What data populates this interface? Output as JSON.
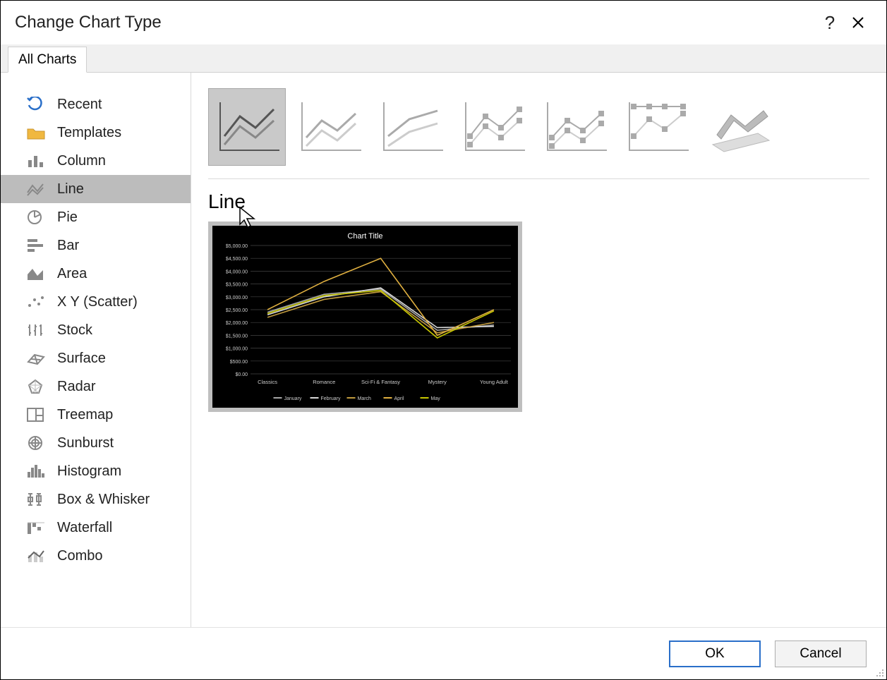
{
  "titlebar": {
    "title": "Change Chart Type",
    "help": "?",
    "close": "✕"
  },
  "tab": {
    "label": "All Charts"
  },
  "sidebar": {
    "items": [
      {
        "label": "Recent",
        "icon": "recent-icon"
      },
      {
        "label": "Templates",
        "icon": "templates-icon"
      },
      {
        "label": "Column",
        "icon": "column-icon"
      },
      {
        "label": "Line",
        "icon": "line-icon"
      },
      {
        "label": "Pie",
        "icon": "pie-icon"
      },
      {
        "label": "Bar",
        "icon": "bar-icon"
      },
      {
        "label": "Area",
        "icon": "area-icon"
      },
      {
        "label": "X Y (Scatter)",
        "icon": "scatter-icon"
      },
      {
        "label": "Stock",
        "icon": "stock-icon"
      },
      {
        "label": "Surface",
        "icon": "surface-icon"
      },
      {
        "label": "Radar",
        "icon": "radar-icon"
      },
      {
        "label": "Treemap",
        "icon": "treemap-icon"
      },
      {
        "label": "Sunburst",
        "icon": "sunburst-icon"
      },
      {
        "label": "Histogram",
        "icon": "histogram-icon"
      },
      {
        "label": "Box & Whisker",
        "icon": "boxwhisker-icon"
      },
      {
        "label": "Waterfall",
        "icon": "waterfall-icon"
      },
      {
        "label": "Combo",
        "icon": "combo-icon"
      }
    ],
    "selected_index": 3
  },
  "subtypes": {
    "selected_index": 0,
    "items": [
      {
        "name": "line"
      },
      {
        "name": "stacked-line"
      },
      {
        "name": "100-stacked-line"
      },
      {
        "name": "line-markers"
      },
      {
        "name": "stacked-line-markers"
      },
      {
        "name": "100-stacked-line-markers"
      },
      {
        "name": "3d-line"
      }
    ]
  },
  "heading": "Line",
  "footer": {
    "ok": "OK",
    "cancel": "Cancel"
  },
  "chart_data": {
    "type": "line",
    "title": "Chart Title",
    "xlabel": "",
    "ylabel": "",
    "ylim": [
      0,
      5000
    ],
    "yticks": [
      "$0.00",
      "$500.00",
      "$1,000.00",
      "$1,500.00",
      "$2,000.00",
      "$2,500.00",
      "$3,000.00",
      "$3,500.00",
      "$4,000.00",
      "$4,500.00",
      "$5,000.00"
    ],
    "categories": [
      "Classics",
      "Romance",
      "Sci-Fi & Fantasy",
      "Mystery",
      "Young Adult"
    ],
    "series": [
      {
        "name": "January",
        "color": "#a6a6a6",
        "values": [
          2400,
          3100,
          3300,
          1700,
          1900
        ]
      },
      {
        "name": "February",
        "color": "#d9d9d9",
        "values": [
          2300,
          3000,
          3350,
          1800,
          1850
        ]
      },
      {
        "name": "March",
        "color": "#c09a3e",
        "values": [
          2200,
          2900,
          3200,
          1600,
          2000
        ]
      },
      {
        "name": "April",
        "color": "#e0b040",
        "values": [
          2500,
          3600,
          4500,
          1500,
          2500
        ]
      },
      {
        "name": "May",
        "color": "#c8c800",
        "values": [
          2350,
          3050,
          3250,
          1400,
          2450
        ]
      }
    ]
  }
}
